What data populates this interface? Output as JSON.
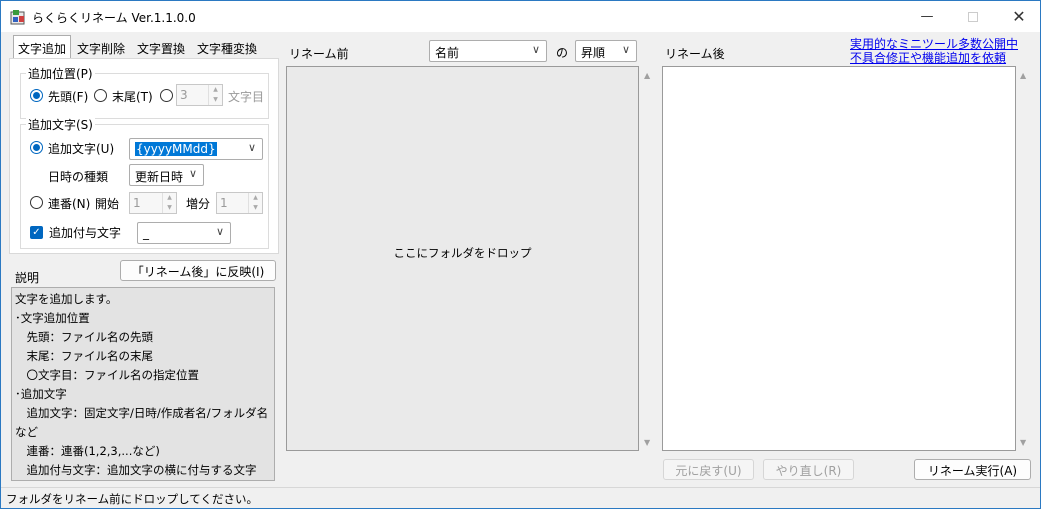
{
  "window": {
    "title": "らくらくリネーム Ver.1.1.0.0"
  },
  "tabs": [
    "文字追加",
    "文字削除",
    "文字置換",
    "文字種変換"
  ],
  "add_position": {
    "group_label": "追加位置(P)",
    "options": [
      "先頭(F)",
      "末尾(T)"
    ],
    "position_value": "3",
    "position_unit": "文字目"
  },
  "add_text": {
    "group_label": "追加文字(S)",
    "text_option_label": "追加文字(U)",
    "text_value": "{yyyyMMdd}",
    "datetime_kind_label": "日時の種類",
    "datetime_kind_value": "更新日時",
    "serial_label": "連番(N)",
    "start_label": "開始",
    "start_value": "1",
    "increment_label": "増分",
    "increment_value": "1",
    "separator_label": "追加付与文字",
    "separator_value": "_"
  },
  "reflect_button": "「リネーム後」に反映(I)",
  "description": {
    "title": "説明",
    "lines": [
      "文字を追加します。",
      "･文字追加位置",
      "　先頭：ファイル名の先頭",
      "　末尾：ファイル名の末尾",
      "　〇文字目：ファイル名の指定位置",
      "･追加文字",
      "　追加文字：固定文字/日時/作成者名/フォルダ名",
      "など",
      "　連番：連番(1,2,3,...など)",
      "　追加付与文字：追加文字の横に付与する文字"
    ]
  },
  "before": {
    "label": "リネーム前",
    "sort_key": "名前",
    "sort_joiner": "の",
    "sort_order": "昇順",
    "drop_hint": "ここにフォルダをドロップ"
  },
  "after": {
    "label": "リネーム後"
  },
  "links": [
    "実用的なミニツール多数公開中",
    "不具合修正や機能追加を依頼"
  ],
  "actions": {
    "undo": "元に戻す(U)",
    "redo": "やり直し(R)",
    "execute": "リネーム実行(A)"
  },
  "status": "フォルダをリネーム前にドロップしてください。"
}
